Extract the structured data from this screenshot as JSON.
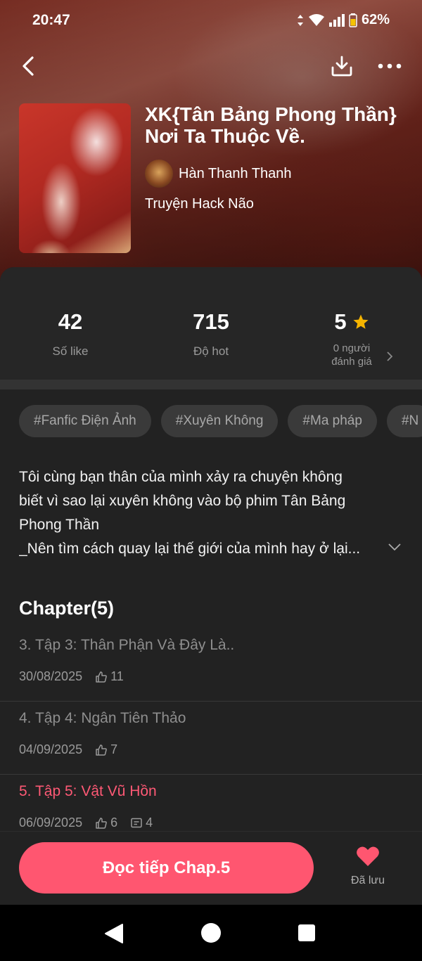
{
  "status_bar": {
    "time": "20:47",
    "battery": "62%"
  },
  "book": {
    "title_line1": "XK{Tân Bảng Phong Thần}",
    "title_line2": "Nơi Ta Thuộc Về.",
    "author": "Hàn Thanh Thanh",
    "category": "Truyện Hack Não"
  },
  "stats": {
    "likes": {
      "value": "42",
      "label": "Số like"
    },
    "hot": {
      "value": "715",
      "label": "Độ hot"
    },
    "rating": {
      "value": "5",
      "label_line1": "0 người",
      "label_line2": "đánh giá"
    }
  },
  "tags": [
    "#Fanfic Điện Ảnh",
    "#Xuyên Không",
    "#Ma pháp",
    "#N"
  ],
  "description": {
    "line1": "Tôi cùng bạn thân của mình xảy ra chuyện không",
    "line2": "biết vì sao lại xuyên không vào bộ phim Tân Bảng",
    "line3": "Phong Thần",
    "line4": "_Nên tìm cách quay lại thế giới của mình hay ở lại..."
  },
  "chapters": {
    "heading": "Chapter(5)",
    "items": [
      {
        "title": "3. Tập 3: Thân Phận Và Đây Là..",
        "date": "30/08/2025",
        "likes": "11"
      },
      {
        "title": "4. Tập 4: Ngân Tiên Thảo",
        "date": "04/09/2025",
        "likes": "7"
      },
      {
        "title": "5. Tập 5: Vật Vũ Hồn",
        "date": "06/09/2025",
        "likes": "6",
        "comments": "4"
      }
    ]
  },
  "actions": {
    "read_button": "Đọc tiếp Chap.5",
    "saved_label": "Đã lưu"
  },
  "colors": {
    "accent": "#ff5670",
    "active_chapter": "#ff5975",
    "star": "#f5b400",
    "sheet_bg": "#222222"
  },
  "icons": [
    "back-arrow-icon",
    "download-icon",
    "more-icon",
    "star-icon",
    "chevron-right-icon",
    "chevron-down-icon",
    "thumb-up-icon",
    "comment-icon",
    "heart-icon"
  ]
}
